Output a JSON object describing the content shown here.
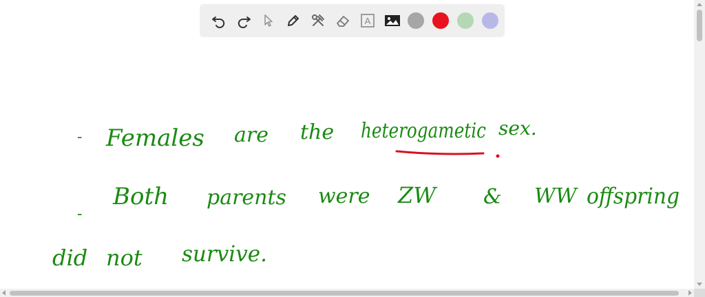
{
  "toolbar": {
    "tools": [
      {
        "name": "undo-icon"
      },
      {
        "name": "redo-icon"
      },
      {
        "name": "select-pointer-icon"
      },
      {
        "name": "pen-icon"
      },
      {
        "name": "tools-icon"
      },
      {
        "name": "eraser-icon"
      },
      {
        "name": "text-tool-icon",
        "label": "A"
      },
      {
        "name": "image-icon"
      }
    ],
    "colors": [
      {
        "name": "gray",
        "hex": "#a6a6a6"
      },
      {
        "name": "red",
        "hex": "#e8131f"
      },
      {
        "name": "light-green",
        "hex": "#b4d8b4"
      },
      {
        "name": "lavender",
        "hex": "#b8b8e8"
      }
    ]
  },
  "canvas": {
    "ink_color": "#1a8a12",
    "accent_color": "#d6131f",
    "lines": [
      {
        "bullet": "-",
        "words": [
          "Females",
          "are",
          "the",
          "heterogametic",
          "sex."
        ]
      },
      {
        "bullet": "-",
        "words": [
          "Both",
          "parents",
          "were",
          "ZW",
          "&",
          "WW",
          "offspring"
        ]
      },
      {
        "bullet": "",
        "words": [
          "did",
          "not",
          "survive."
        ]
      }
    ]
  }
}
